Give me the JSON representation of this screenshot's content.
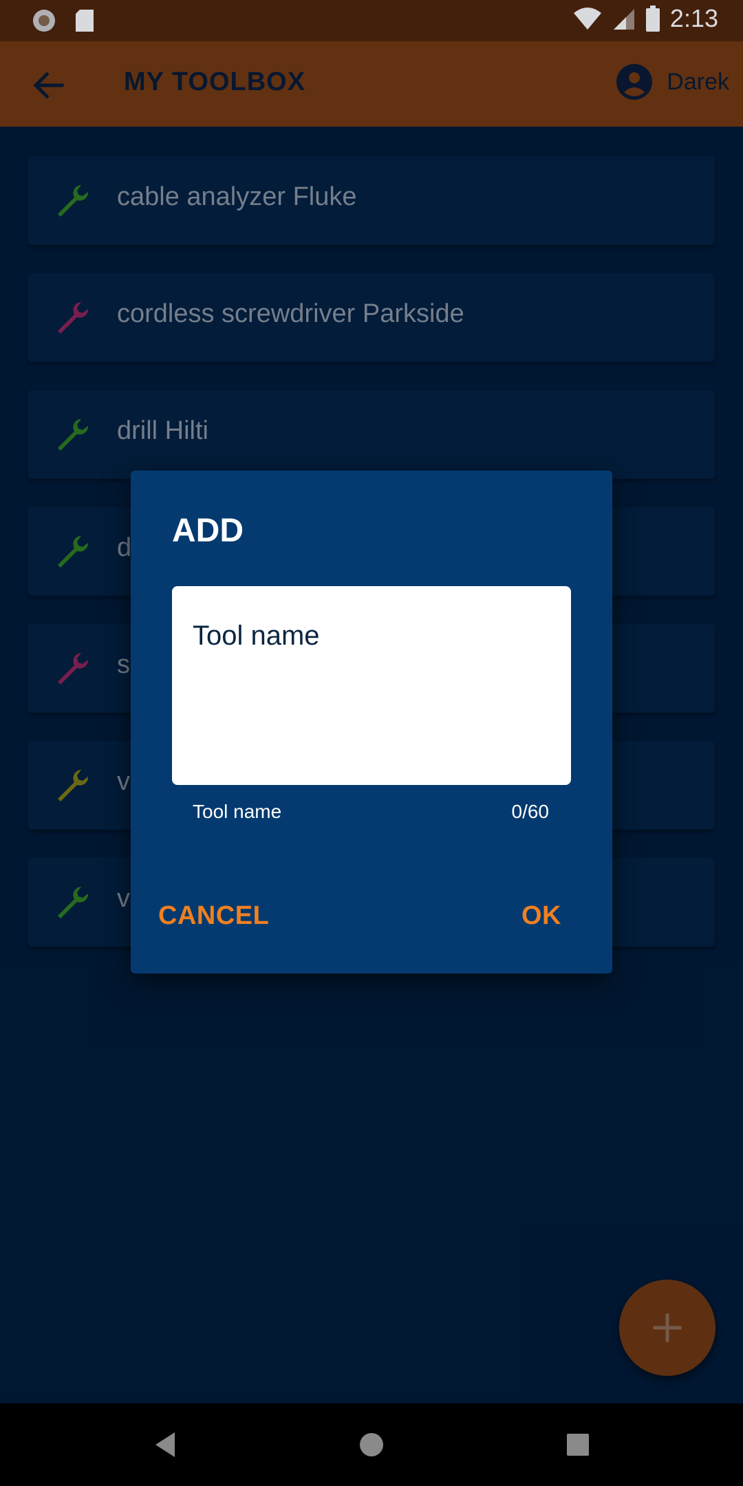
{
  "status_bar": {
    "time": "2:13"
  },
  "app_bar": {
    "title": "MY TOOLBOX",
    "user_name": "Darek"
  },
  "tools": [
    {
      "label": "cable analyzer Fluke",
      "color": "#2e7d1f"
    },
    {
      "label": "cordless screwdriver Parkside",
      "color": "#8e2457"
    },
    {
      "label": "drill Hilti",
      "color": "#2e7d1f"
    },
    {
      "label": "d",
      "color": "#2e7d1f"
    },
    {
      "label": "s",
      "color": "#8e2457"
    },
    {
      "label": "v",
      "color": "#7d7a12"
    },
    {
      "label": "v",
      "color": "#2e7d1f"
    }
  ],
  "dialog": {
    "title": "ADD",
    "input_text": "Tool name",
    "helper": "Tool name",
    "counter": "0/60",
    "cancel_label": "CANCEL",
    "ok_label": "OK"
  },
  "colors": {
    "accent": "#f08020",
    "app_bar": "#733910",
    "dialog_bg": "#043a6f",
    "background": "#001a36"
  },
  "icons": {
    "back": "arrow-back-icon",
    "account": "account-circle-icon",
    "tool": "wrench-icon",
    "fab": "plus-icon"
  }
}
